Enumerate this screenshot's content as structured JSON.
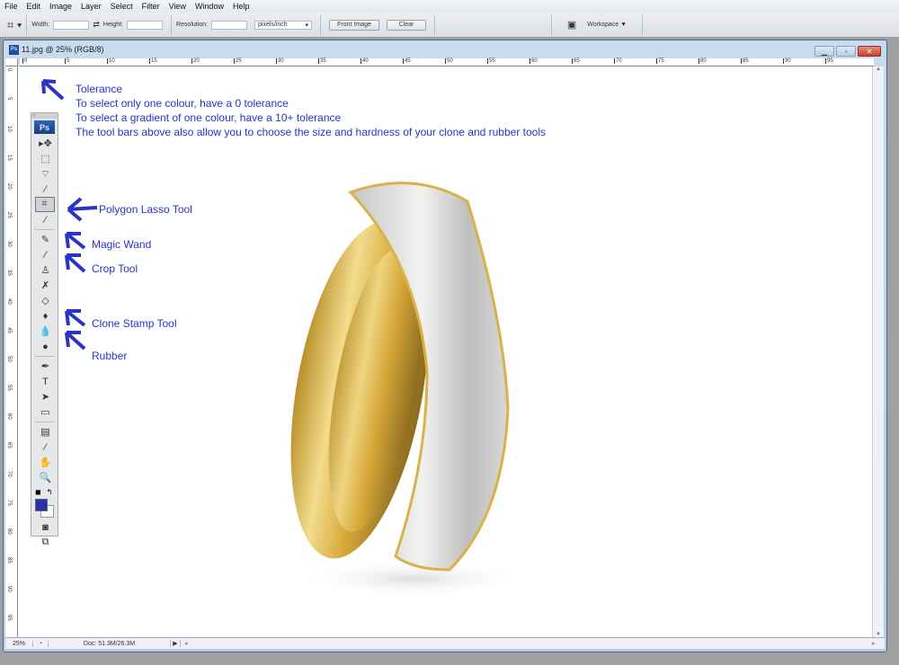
{
  "menu": [
    "File",
    "Edit",
    "Image",
    "Layer",
    "Select",
    "Filter",
    "View",
    "Window",
    "Help"
  ],
  "options": {
    "width_label": "Width:",
    "height_label": "Height:",
    "resolution_label": "Resolution:",
    "unit": "pixels/inch",
    "front_image": "Front Image",
    "clear": "Clear",
    "workspace": "Workspace ▼"
  },
  "document": {
    "title": "11.jpg @ 25% (RGB/8)",
    "zoom": "25%",
    "doc_size": "Doc: 51.3M/26.3M"
  },
  "ruler": {
    "h": [
      "0",
      "5",
      "10",
      "15",
      "20",
      "25",
      "30",
      "35",
      "40",
      "45",
      "50",
      "55",
      "60",
      "65",
      "70",
      "75",
      "80",
      "85",
      "90",
      "95"
    ],
    "v": [
      "0",
      "5",
      "10",
      "15",
      "20",
      "25",
      "30",
      "35",
      "40",
      "45",
      "50",
      "55",
      "60",
      "65",
      "70",
      "75",
      "80",
      "85",
      "90",
      "95"
    ]
  },
  "notes": {
    "tolerance": [
      "Tolerance",
      "To select only one colour, have a 0 tolerance",
      "To select a gradient of one colour, have a 10+ tolerance",
      "The tool bars above also allow you to choose the size and hardness of your clone and rubber tools"
    ],
    "polygon_lasso": "Polygon Lasso Tool",
    "magic_wand": "Magic Wand",
    "crop": "Crop Tool",
    "clone": "Clone Stamp Tool",
    "rubber": "Rubber"
  },
  "tools": [
    {
      "name": "move",
      "glyph": "▸✥"
    },
    {
      "name": "marquee",
      "glyph": "⬚"
    },
    {
      "name": "polygon-lasso",
      "glyph": "⌔"
    },
    {
      "name": "magic-wand",
      "glyph": "⁄"
    },
    {
      "name": "crop",
      "glyph": "⌗"
    },
    {
      "name": "slice",
      "glyph": "⁄"
    },
    {
      "name": "healing",
      "glyph": "✎"
    },
    {
      "name": "brush",
      "glyph": "⁄"
    },
    {
      "name": "clone-stamp",
      "glyph": "♙"
    },
    {
      "name": "history-brush",
      "glyph": "✗"
    },
    {
      "name": "eraser",
      "glyph": "◇"
    },
    {
      "name": "paint-bucket",
      "glyph": "♦"
    },
    {
      "name": "blur",
      "glyph": "💧"
    },
    {
      "name": "dodge",
      "glyph": "●"
    },
    {
      "name": "pen",
      "glyph": "✒"
    },
    {
      "name": "type",
      "glyph": "T"
    },
    {
      "name": "path-select",
      "glyph": "➤"
    },
    {
      "name": "shape",
      "glyph": "▭"
    },
    {
      "name": "notes",
      "glyph": "▤"
    },
    {
      "name": "eyedropper",
      "glyph": "⁄"
    },
    {
      "name": "hand",
      "glyph": "✋"
    },
    {
      "name": "zoom",
      "glyph": "🔍"
    }
  ],
  "colors": {
    "foreground": "#2b2fa8",
    "background": "#ffffff",
    "annotation": "#2a33c8"
  }
}
